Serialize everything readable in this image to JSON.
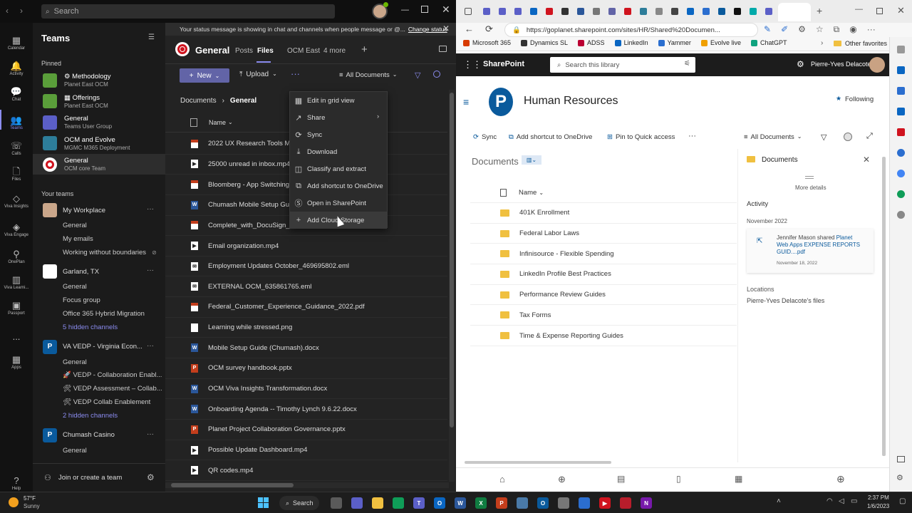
{
  "teams": {
    "search_placeholder": "Search",
    "rail": [
      {
        "label": "Calendar",
        "icon": "calendar-icon",
        "glyph": "▦"
      },
      {
        "label": "Activity",
        "icon": "bell-icon",
        "glyph": "🔔"
      },
      {
        "label": "Chat",
        "icon": "chat-icon",
        "glyph": "💬"
      },
      {
        "label": "Teams",
        "icon": "teams-icon",
        "glyph": "👥"
      },
      {
        "label": "Calls",
        "icon": "phone-icon",
        "glyph": "☏"
      },
      {
        "label": "Files",
        "icon": "file-icon",
        "glyph": "🗋"
      },
      {
        "label": "Viva Insights",
        "icon": "insights-icon",
        "glyph": "◇"
      },
      {
        "label": "Viva Engage",
        "icon": "engage-icon",
        "glyph": "◈"
      },
      {
        "label": "OnePlan",
        "icon": "oneplan-icon",
        "glyph": "⚲"
      },
      {
        "label": "Viva Learni...",
        "icon": "learning-icon",
        "glyph": "▥"
      },
      {
        "label": "Passport",
        "icon": "passport-icon",
        "glyph": "▣"
      },
      {
        "label": "...",
        "icon": "more-icon",
        "glyph": ""
      },
      {
        "label": "Apps",
        "icon": "apps-icon",
        "glyph": "▦"
      },
      {
        "label": "Help",
        "icon": "help-icon",
        "glyph": "?"
      }
    ],
    "list_title": "Teams",
    "pinned_label": "Pinned",
    "pinned": [
      {
        "title": "Methodology",
        "sub": "Planet East OCM",
        "prefix": "⚙ "
      },
      {
        "title": "Offerings",
        "sub": "Planet East OCM",
        "prefix": "▦ "
      },
      {
        "title": "General",
        "sub": "Teams User Group",
        "prefix": ""
      },
      {
        "title": "OCM and Evolve",
        "sub": "MGMC M365 Deployment",
        "prefix": ""
      },
      {
        "title": "General",
        "sub": "OCM core Team",
        "prefix": ""
      }
    ],
    "your_teams_label": "Your teams",
    "teams_tree": [
      {
        "kind": "team",
        "label": "My Workplace"
      },
      {
        "kind": "ch",
        "label": "General"
      },
      {
        "kind": "ch",
        "label": "My emails"
      },
      {
        "kind": "ch",
        "label": "Working without boundaries"
      },
      {
        "kind": "team",
        "label": "Garland, TX"
      },
      {
        "kind": "ch",
        "label": "General"
      },
      {
        "kind": "ch",
        "label": "Focus group"
      },
      {
        "kind": "ch",
        "label": "Office 365 Hybrid Migration"
      },
      {
        "kind": "link",
        "label": "5 hidden channels"
      },
      {
        "kind": "team",
        "label": "VA VEDP - Virginia Econ..."
      },
      {
        "kind": "ch",
        "label": "General"
      },
      {
        "kind": "ch",
        "label": "🚀 VEDP - Collaboration Enabl..."
      },
      {
        "kind": "ch",
        "label": "🛠 VEDP Assessment – Collab..."
      },
      {
        "kind": "ch",
        "label": "🛠 VEDP Collab Enablement"
      },
      {
        "kind": "link",
        "label": "2 hidden channels"
      },
      {
        "kind": "team",
        "label": "Chumash Casino"
      },
      {
        "kind": "ch",
        "label": "General"
      }
    ],
    "join_label": "Join or create a team",
    "banner_text": "Your status message is showing in chat and channels when people message or @...",
    "banner_link": "Change status",
    "channel_name": "General",
    "tabs": [
      "Posts",
      "Files",
      "OCM East",
      "4 more"
    ],
    "toolbar": {
      "new": "New",
      "upload": "Upload",
      "view": "All Documents"
    },
    "breadcrumb": {
      "root": "Documents",
      "current": "General"
    },
    "col_name": "Name",
    "files": [
      {
        "name": "2022 UX Research Tools Ma",
        "type": "pdf"
      },
      {
        "name": "25000 unread in inbox.mp4",
        "type": "mp4"
      },
      {
        "name": "Bloomberg - App Switching",
        "type": "pdf"
      },
      {
        "name": "Chumash Mobile Setup Gui",
        "type": "docx"
      },
      {
        "name": "Complete_with_DocuSign_P",
        "type": "pdf"
      },
      {
        "name": "Email organization.mp4",
        "type": "mp4"
      },
      {
        "name": "Employment Updates  October_469695802.eml",
        "type": "eml"
      },
      {
        "name": "EXTERNAL OCM_635861765.eml",
        "type": "eml"
      },
      {
        "name": "Federal_Customer_Experience_Guidance_2022.pdf",
        "type": "pdf"
      },
      {
        "name": "Learning while stressed.png",
        "type": "png"
      },
      {
        "name": "Mobile Setup Guide (Chumash).docx",
        "type": "docx"
      },
      {
        "name": "OCM survey handbook.pptx",
        "type": "pptx"
      },
      {
        "name": "OCM Viva Insights Transformation.docx",
        "type": "docx"
      },
      {
        "name": "Onboarding Agenda -- Timothy Lynch 9.6.22.docx",
        "type": "docx"
      },
      {
        "name": "Planet Project Collaboration Governance.pptx",
        "type": "pptx"
      },
      {
        "name": "Possible Update Dashboard.mp4",
        "type": "mp4"
      },
      {
        "name": "QR codes.mp4",
        "type": "mp4"
      }
    ],
    "context_menu": [
      {
        "label": "Edit in grid view",
        "icon": "grid-icon",
        "glyph": "▦"
      },
      {
        "label": "Share",
        "icon": "share-icon",
        "glyph": "↗"
      },
      {
        "label": "Sync",
        "icon": "sync-icon",
        "glyph": "⟳"
      },
      {
        "label": "Download",
        "icon": "download-icon",
        "glyph": "⤓"
      },
      {
        "label": "Classify and extract",
        "icon": "classify-icon",
        "glyph": "◫"
      },
      {
        "label": "Add shortcut to OneDrive",
        "icon": "shortcut-icon",
        "glyph": "⧉"
      },
      {
        "label": "Open in SharePoint",
        "icon": "sharepoint-icon",
        "glyph": "Ⓢ"
      },
      {
        "label": "Add Cloud Storage",
        "icon": "plus-icon",
        "glyph": "+"
      }
    ]
  },
  "edge": {
    "url": "https://goplanet.sharepoint.com/sites/HR/Shared%20Documen...",
    "favorites": [
      "Microsoft 365",
      "Dynamics SL",
      "ADSS",
      "LinkedIn",
      "Yammer",
      "Evolve live",
      "ChatGPT"
    ],
    "other_favorites": "Other favorites",
    "sp_brand": "SharePoint",
    "sp_search": "Search this library",
    "user_name": "Pierre-Yves Delacote",
    "site_title": "Human Resources",
    "following": "Following",
    "cmd": {
      "sync": "Sync",
      "shortcut": "Add shortcut to OneDrive",
      "pin": "Pin to Quick access",
      "view": "All Documents"
    },
    "lib_title": "Documents",
    "col_name": "Name",
    "folders": [
      "401K Enrollment",
      "Federal Labor Laws",
      "Infinisource - Flexible Spending",
      "LinkedIn Profile Best Practices",
      "Performance Review Guides",
      "Tax Forms",
      "Time & Expense Reporting Guides"
    ],
    "details": {
      "title": "Documents",
      "more": "More details",
      "activity": "Activity",
      "month": "November 2022",
      "actor": "Jennifer Mason shared",
      "doc": "Planet Web Apps EXPENSE REPORTS GUID....pdf",
      "date": "November 18, 2022",
      "locations": "Locations",
      "location": "Pierre-Yves Delacote's files"
    }
  },
  "taskbar": {
    "weather_temp": "57°F",
    "weather_desc": "Sunny",
    "search": "Search",
    "time": "2:37 PM",
    "date": "1/6/2023"
  }
}
